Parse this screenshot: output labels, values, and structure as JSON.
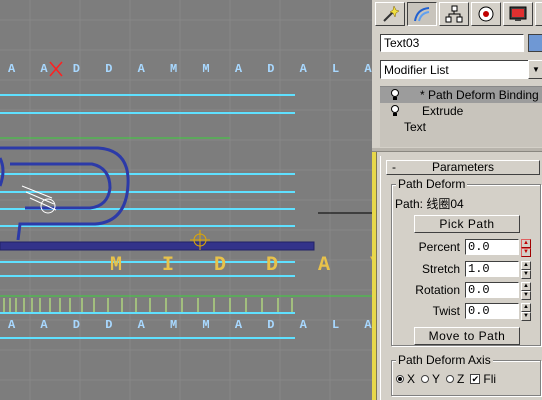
{
  "viewport": {
    "text_rows": [
      {
        "text": "A A D D A M   M A D A L A A A",
        "color": "#a8d8ff"
      },
      {
        "text": "M I D D A Y",
        "color": "#e8c24a"
      },
      {
        "text": "A A D D A M   M A D A L A A A",
        "color": "#a8d8ff"
      }
    ]
  },
  "panel": {
    "tabs": [
      {
        "name": "create-tab",
        "icon": "wand-icon"
      },
      {
        "name": "modify-tab",
        "icon": "modify-arc-icon"
      },
      {
        "name": "hierarchy-tab",
        "icon": "hierarchy-icon"
      },
      {
        "name": "motion-tab",
        "icon": "motion-icon"
      },
      {
        "name": "display-tab",
        "icon": "display-icon"
      },
      {
        "name": "utilities-tab",
        "icon": "hammer-icon"
      }
    ],
    "object_name": "Text03",
    "color_swatch": "#6f98d4",
    "modifier_list_label": "Modifier List",
    "stack": [
      {
        "label": "* Path Deform Binding",
        "selected": true,
        "bulb": true
      },
      {
        "label": "Extrude",
        "selected": false,
        "bulb": true
      },
      {
        "label": "Text",
        "selected": false,
        "bulb": false
      }
    ],
    "rollout": {
      "header": "Parameters",
      "path_deform_group": "Path Deform",
      "path_label": "Path: 线圈04",
      "pick_path": "Pick Path",
      "percent": {
        "label": "Percent",
        "value": "0.0"
      },
      "stretch": {
        "label": "Stretch",
        "value": "1.0"
      },
      "rotation": {
        "label": "Rotation",
        "value": "0.0"
      },
      "twist": {
        "label": "Twist",
        "value": "0.0"
      },
      "move_to_path": "Move to Path",
      "axis_group": "Path Deform Axis",
      "axis_options": [
        {
          "label": "X",
          "selected": true
        },
        {
          "label": "Y",
          "selected": false
        },
        {
          "label": "Z",
          "selected": false
        }
      ],
      "flip_label": "Fli",
      "flip_checked": true
    }
  }
}
